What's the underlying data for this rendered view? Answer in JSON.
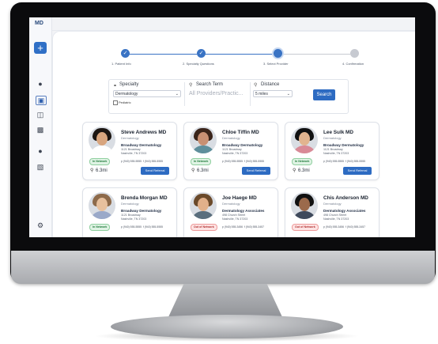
{
  "app": {
    "logo": "MD",
    "add_label": "+"
  },
  "sidebar": {
    "icons": [
      "users-icon",
      "calendar-icon",
      "clipboard-icon",
      "printer-icon",
      "group-icon",
      "document-icon",
      "gear-icon"
    ]
  },
  "stepper": {
    "steps": [
      {
        "label": "1. Patient Info",
        "status": "done"
      },
      {
        "label": "2. Specialty Questions",
        "status": "done"
      },
      {
        "label": "3. Select Provider",
        "status": "current"
      },
      {
        "label": "4. Confirmation",
        "status": "todo"
      }
    ],
    "check": "✓"
  },
  "search": {
    "specialty_label": "Specialty",
    "specialty_value": "Dermatology",
    "pediatric_label": "Pediatric",
    "term_label": "Search Term",
    "term_placeholder": "All Providers/Practic...",
    "distance_label": "Distance",
    "distance_value": "5 miles",
    "button": "Search"
  },
  "providers": [
    {
      "name": "Steve Andrews MD",
      "specialty": "Dermatology",
      "clinic": "Broadway Dermatology",
      "address1": "1121 Broadway",
      "address2": "Nashville, TN 37203",
      "network": "In Network",
      "phone": "p (940) 555-5555",
      "fax": "f (940) 555-5555",
      "distance": "6.3mi",
      "button": "Send Referral"
    },
    {
      "name": "Chloe Tiffin MD",
      "specialty": "Dermatology",
      "clinic": "Broadway Dermatology",
      "address1": "1121 Broadway",
      "address2": "Nashville, TN 37203",
      "network": "In Network",
      "phone": "p (940) 555-5555",
      "fax": "f (940) 555-5555",
      "distance": "6.3mi",
      "button": "Send Referral"
    },
    {
      "name": "Lee Sulk MD",
      "specialty": "Dermatology",
      "clinic": "Broadway Dermatology",
      "address1": "1121 Broadway",
      "address2": "Nashville, TN 37203",
      "network": "In Network",
      "phone": "p (940) 555-5555",
      "fax": "f (940) 555-5555",
      "distance": "6.3mi",
      "button": "Send Referral"
    },
    {
      "name": "Brenda Morgan MD",
      "specialty": "Dermatology",
      "clinic": "Broadway Dermatology",
      "address1": "1121 Broadway",
      "address2": "Nashville, TN 37203",
      "network": "In Network",
      "phone": "p (940) 555-5555",
      "fax": "f (940) 555-5555",
      "distance": "",
      "button": ""
    },
    {
      "name": "Joe Haege MD",
      "specialty": "Dermatology",
      "clinic": "Dermatology Associates",
      "address1": "498 Church Street",
      "address2": "Nashville, TN 37203",
      "network": "Out of Network",
      "phone": "p (940) 555-3456",
      "fax": "f (940) 555-3457",
      "distance": "",
      "button": ""
    },
    {
      "name": "Chis Anderson MD",
      "specialty": "Dermatology",
      "clinic": "Dermatology Associates",
      "address1": "498 Church Street",
      "address2": "Nashville, TN 37203",
      "network": "Out of Network",
      "phone": "p (940) 555-3456",
      "fax": "f (940) 555-3457",
      "distance": "",
      "button": ""
    }
  ],
  "colors": {
    "accent": "#2d6bc2",
    "in_network": "#1f7a3a",
    "out_network": "#b23030"
  }
}
